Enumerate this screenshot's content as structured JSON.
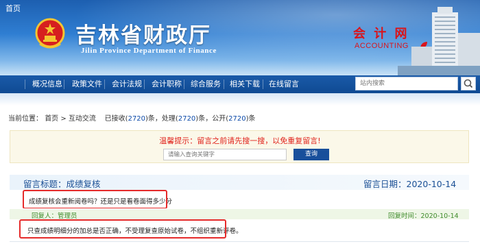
{
  "header": {
    "site_title": "吉林省财政厅",
    "site_subtitle": "Jilin Province Department of Finance",
    "section_cn": "会 计 网",
    "section_en": "ACCOUNTING"
  },
  "nav": {
    "items": [
      "首页",
      "概况信息",
      "政策文件",
      "会计法规",
      "会计职称",
      "综合服务",
      "相关下载",
      "在线留言"
    ],
    "search_placeholder": "站内搜索"
  },
  "breadcrumb": {
    "prefix": "当前位置：",
    "home": "首页",
    "sep": " > ",
    "current": "互动交流",
    "received_label": "已接收(",
    "received": "2720",
    "processed_label": ")条，处理(",
    "processed": "2720",
    "public_label": ")条，公开(",
    "public": "2720",
    "suffix": ")条"
  },
  "tips": {
    "text": "温馨提示：留言之前请先搜一搜，以免重复留言!",
    "search_placeholder": "请输入查询关键字",
    "search_button": "查询"
  },
  "message": {
    "title_label": "留言标题：",
    "title": "成绩复核",
    "date_label": "留言日期：",
    "date": "2020-10-14",
    "question": "成绩复核会重新阅卷吗？还是只是看卷面得多少分",
    "reply_by_label": "回复人：",
    "reply_by": "管理员",
    "reply_time_label": "回复时间：",
    "reply_time": "2020-10-14",
    "answer": "只查成绩明细分的加总是否正确，不受理复查原始试卷，不组织重新评卷。"
  },
  "colors": {
    "nav_bg": "#0f4a93",
    "accent_red": "#e52a2a",
    "title_blue": "#1a4f95",
    "reply_green": "#3f8b2b"
  }
}
